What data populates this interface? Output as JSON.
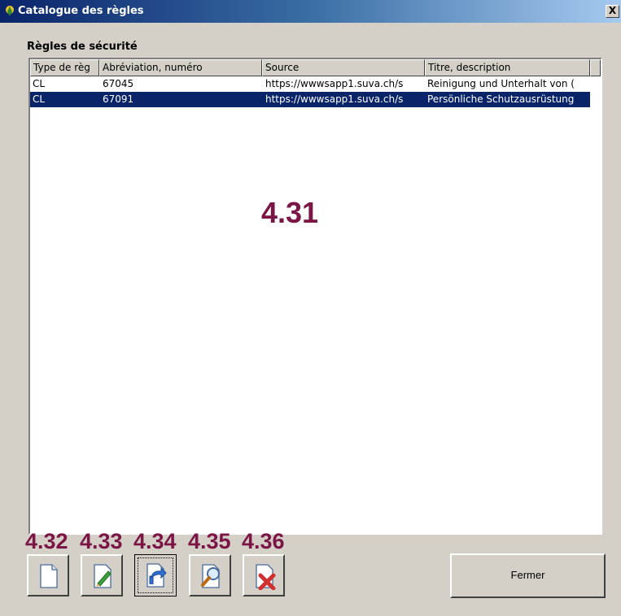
{
  "window": {
    "title": "Catalogue des règles",
    "close_glyph": "X"
  },
  "section_label": "Règles de sécurité",
  "table": {
    "columns": [
      "Type de règ",
      "Abréviation, numéro",
      "Source",
      "Titre, description"
    ],
    "rows": [
      {
        "type": "CL",
        "abbrev": "67045",
        "source": "https://wwwsapp1.suva.ch/s",
        "title": "Reinigung und Unterhalt von (",
        "selected": false
      },
      {
        "type": "CL",
        "abbrev": "67091",
        "source": "https://wwwsapp1.suva.ch/s",
        "title": "Persönliche Schutzausrüstung",
        "selected": true
      }
    ]
  },
  "annotations": {
    "main": "4.31",
    "buttons": [
      "4.32",
      "4.33",
      "4.34",
      "4.35",
      "4.36"
    ]
  },
  "toolbar": {
    "icons": [
      "new-document-icon",
      "edit-pencil-icon",
      "open-link-icon",
      "preview-magnifier-icon",
      "delete-document-icon"
    ]
  },
  "close_button_label": "Fermer",
  "colors": {
    "selection": "#0a246a",
    "annotation": "#7b1545",
    "face": "#d4d0c8"
  }
}
